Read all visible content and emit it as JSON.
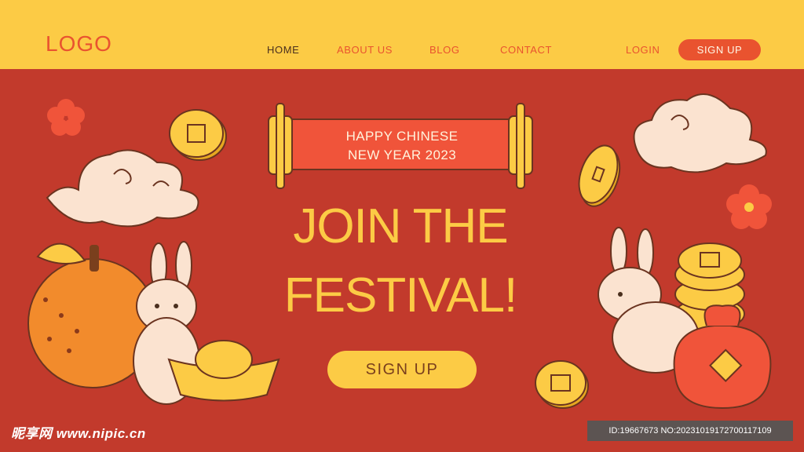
{
  "header": {
    "logo": "LOGO",
    "nav": [
      {
        "label": "HOME"
      },
      {
        "label": "ABOUT US"
      },
      {
        "label": "BLOG"
      },
      {
        "label": "CONTACT"
      }
    ],
    "login": "LOGIN",
    "signup": "SIGN UP"
  },
  "hero": {
    "banner_line1": "HAPPY CHINESE",
    "banner_line2": "NEW YEAR 2023",
    "title_line1": "JOIN THE",
    "title_line2": "FESTIVAL!",
    "cta": "SIGN UP"
  },
  "watermark": {
    "site": "昵享网 www.nipic.cn",
    "id": "ID:19667673 NO:20231019172700117109"
  },
  "colors": {
    "background": "#c23a2c",
    "header": "#fccb45",
    "accent": "#e9532f",
    "gold": "#fccb45",
    "cream": "#fbe3d0"
  }
}
